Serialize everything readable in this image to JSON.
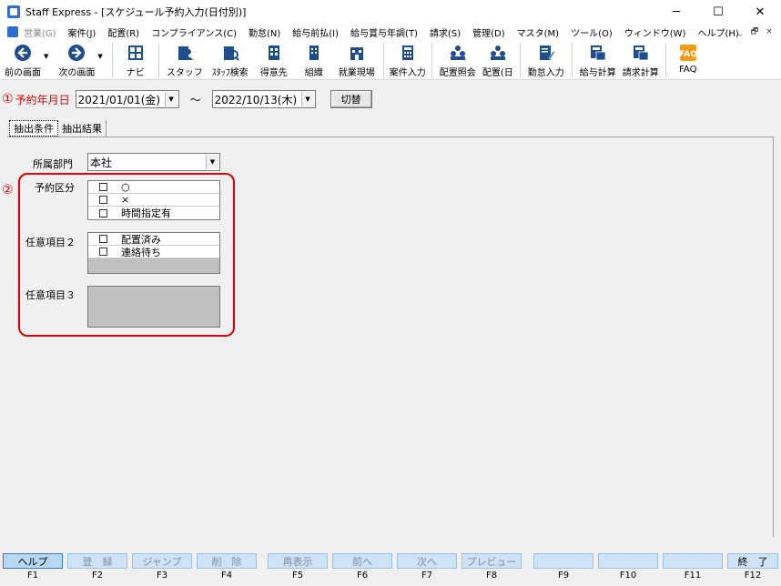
{
  "window": {
    "title": "Staff Express - [スケジュール予約入力(日付別)]",
    "minimize": "─",
    "maximize": "☐",
    "close": "✕"
  },
  "menu": [
    {
      "label": "営業(G)",
      "disabled": true
    },
    {
      "label": "案件(J)"
    },
    {
      "label": "配置(R)"
    },
    {
      "label": "コンプライアンス(C)"
    },
    {
      "label": "勤怠(N)"
    },
    {
      "label": "給与前払(I)"
    },
    {
      "label": "給与賞与年調(T)"
    },
    {
      "label": "請求(S)"
    },
    {
      "label": "管理(D)"
    },
    {
      "label": "マスタ(M)"
    },
    {
      "label": "ツール(O)"
    },
    {
      "label": "ウィンドウ(W)"
    },
    {
      "label": "ヘルプ(H)"
    }
  ],
  "mdi": {
    "min": "_",
    "restore": "🗗",
    "close": "×"
  },
  "toolbar": {
    "prev": "前の画面",
    "next": "次の画面",
    "navi": "ナビ",
    "staff": "スタッフ",
    "staff_search": "ｽﾀｯﾌ検索",
    "client": "得意先",
    "org": "組織",
    "site": "就業現場",
    "case_input": "案件入力",
    "placement_query": "配置照会",
    "placement_day": "配置(日",
    "attendance_input": "勤怠入力",
    "pay_calc": "給与計算",
    "bill_calc": "請求計算",
    "faq": "FAQ"
  },
  "form": {
    "marker1": "①",
    "date_label": "予約年月日",
    "date_from": "2021/01/01(金)",
    "tilde": "～",
    "date_to": "2022/10/13(木)",
    "switch_button": "切替",
    "tab_conditions": "抽出条件",
    "tab_results": "抽出結果",
    "dept_label": "所属部門",
    "dept_value": "本社",
    "marker2": "②",
    "reserve_label": "予約区分",
    "reserve_items": [
      "○",
      "×",
      "時間指定有"
    ],
    "optional2_label": "任意項目２",
    "optional2_items": [
      "配置済み",
      "連絡待ち"
    ],
    "optional3_label": "任意項目３"
  },
  "fkeys": [
    {
      "label": "ヘルプ",
      "key": "F1",
      "active": true
    },
    {
      "label": "登　録",
      "key": "F2"
    },
    {
      "label": "ジャンプ",
      "key": "F3"
    },
    {
      "label": "削　除",
      "key": "F4"
    },
    {
      "label": "再表示",
      "key": "F5"
    },
    {
      "label": "前へ",
      "key": "F6"
    },
    {
      "label": "次へ",
      "key": "F7"
    },
    {
      "label": "プレビュー",
      "key": "F8"
    },
    {
      "label": "",
      "key": "F9"
    },
    {
      "label": "",
      "key": "F10"
    },
    {
      "label": "",
      "key": "F11"
    },
    {
      "label": "終　了",
      "key": "F12",
      "end": true
    }
  ],
  "colors": {
    "accent_red": "#e00000",
    "fkey_bg": "#cfe3f6",
    "icon_blue": "#1f4e8c"
  }
}
